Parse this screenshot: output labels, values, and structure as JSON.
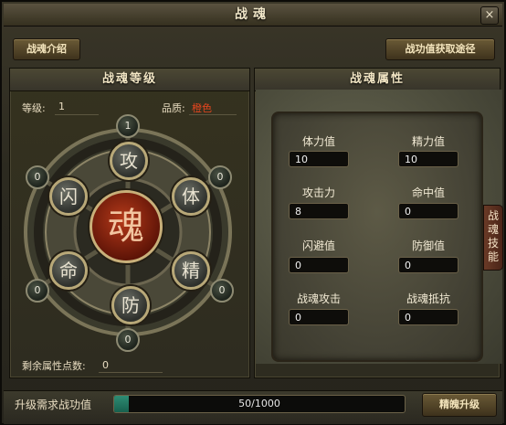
{
  "window": {
    "title": "战魂",
    "close_glyph": "×"
  },
  "toolbar": {
    "intro_button": "战魂介绍",
    "acquire_button": "战功值获取途径"
  },
  "level_panel": {
    "title": "战魂等级",
    "level_label": "等级:",
    "level_value": "1",
    "quality_label": "品质:",
    "quality_value": "橙色",
    "quality_color": "#e8461e",
    "remaining_label": "剩余属性点数:",
    "remaining_value": "0",
    "center_glyph": "魂",
    "orbs": [
      {
        "name": "攻",
        "count": "1"
      },
      {
        "name": "体",
        "count": "0"
      },
      {
        "name": "精",
        "count": "0"
      },
      {
        "name": "防",
        "count": "0"
      },
      {
        "name": "命",
        "count": "0"
      },
      {
        "name": "闪",
        "count": "0"
      }
    ]
  },
  "attr_panel": {
    "title": "战魂属性",
    "attributes": [
      {
        "label": "体力值",
        "value": "10"
      },
      {
        "label": "精力值",
        "value": "10"
      },
      {
        "label": "攻击力",
        "value": "8"
      },
      {
        "label": "命中值",
        "value": "0"
      },
      {
        "label": "闪避值",
        "value": "0"
      },
      {
        "label": "防御值",
        "value": "0"
      },
      {
        "label": "战魂攻击",
        "value": "0"
      },
      {
        "label": "战魂抵抗",
        "value": "0"
      }
    ]
  },
  "side_tab": {
    "label": "战魂技能"
  },
  "footer": {
    "label": "升级需求战功值",
    "progress_text": "50/1000",
    "progress_fraction": 0.05,
    "button_label": "精魄升级"
  }
}
